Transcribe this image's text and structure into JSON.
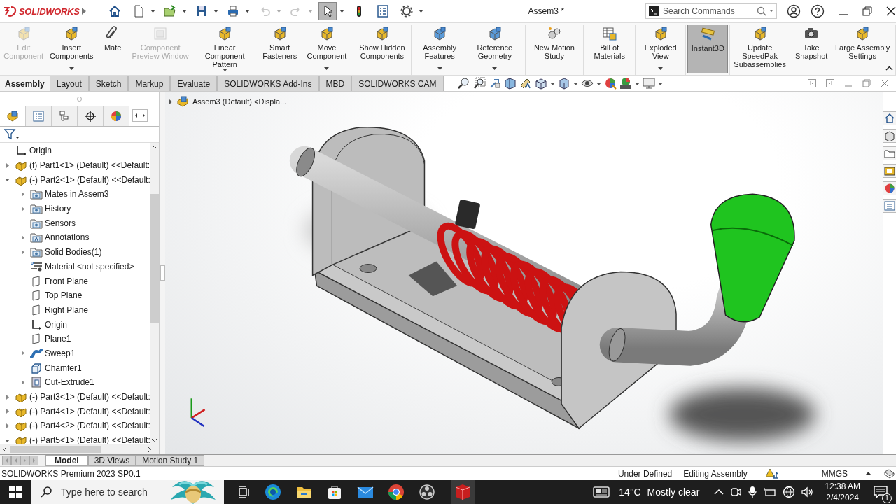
{
  "app": {
    "logo": "SOLIDWORKS"
  },
  "window": {
    "title": "Assem3 *"
  },
  "search": {
    "placeholder": "Search Commands"
  },
  "quick_access": [
    {
      "disabled": false,
      "selected": false,
      "dropdown": false
    },
    {
      "disabled": false,
      "selected": false,
      "dropdown": true
    },
    {
      "disabled": false,
      "selected": false,
      "dropdown": true
    },
    {
      "disabled": false,
      "selected": false,
      "dropdown": true
    },
    {
      "disabled": false,
      "selected": false,
      "dropdown": true
    },
    {
      "disabled": true,
      "selected": false,
      "dropdown": true
    },
    {
      "disabled": true,
      "selected": false,
      "dropdown": true
    },
    {
      "disabled": false,
      "selected": true,
      "dropdown": true
    },
    {
      "disabled": false,
      "selected": false,
      "dropdown": false
    },
    {
      "disabled": false,
      "selected": false,
      "dropdown": false
    },
    {
      "disabled": false,
      "selected": false,
      "dropdown": true
    }
  ],
  "ribbon": [
    {
      "items": [
        {
          "label": "Edit Component",
          "disabled": true,
          "dropdown": false,
          "selected": false
        },
        {
          "label": "Insert Components",
          "disabled": false,
          "dropdown": true,
          "selected": false
        },
        {
          "label": "Mate",
          "disabled": false,
          "dropdown": false,
          "selected": false
        },
        {
          "label": "Component Preview Window",
          "disabled": true,
          "dropdown": false,
          "selected": false
        },
        {
          "label": "Linear Component Pattern",
          "disabled": false,
          "dropdown": true,
          "selected": false
        },
        {
          "label": "Smart Fasteners",
          "disabled": false,
          "dropdown": false,
          "selected": false
        },
        {
          "label": "Move Component",
          "disabled": false,
          "dropdown": true,
          "selected": false
        }
      ]
    },
    {
      "items": [
        {
          "label": "Show Hidden Components",
          "disabled": false,
          "dropdown": false,
          "selected": false
        }
      ]
    },
    {
      "items": [
        {
          "label": "Assembly Features",
          "disabled": false,
          "dropdown": true,
          "selected": false
        },
        {
          "label": "Reference Geometry",
          "disabled": false,
          "dropdown": true,
          "selected": false
        }
      ]
    },
    {
      "items": [
        {
          "label": "New Motion Study",
          "disabled": false,
          "dropdown": false,
          "selected": false
        }
      ]
    },
    {
      "items": [
        {
          "label": "Bill of Materials",
          "disabled": false,
          "dropdown": false,
          "selected": false
        }
      ]
    },
    {
      "items": [
        {
          "label": "Exploded View",
          "disabled": false,
          "dropdown": true,
          "selected": false
        }
      ]
    },
    {
      "items": [
        {
          "label": "Instant3D",
          "disabled": false,
          "dropdown": false,
          "selected": true
        }
      ]
    },
    {
      "items": [
        {
          "label": "Update SpeedPak Subassemblies",
          "disabled": false,
          "dropdown": false,
          "selected": false
        }
      ]
    },
    {
      "items": [
        {
          "label": "Take Snapshot",
          "disabled": false,
          "dropdown": false,
          "selected": false
        },
        {
          "label": "Large Assembly Settings",
          "disabled": false,
          "dropdown": false,
          "selected": false
        }
      ]
    }
  ],
  "command_tabs": [
    {
      "label": "Assembly",
      "selected": true
    },
    {
      "label": "Layout",
      "selected": false
    },
    {
      "label": "Sketch",
      "selected": false
    },
    {
      "label": "Markup",
      "selected": false
    },
    {
      "label": "Evaluate",
      "selected": false
    },
    {
      "label": "SOLIDWORKS Add-Ins",
      "selected": false
    },
    {
      "label": "MBD",
      "selected": false
    },
    {
      "label": "SOLIDWORKS CAM",
      "selected": false
    }
  ],
  "panel_tabs": [
    {
      "selected": true
    },
    {
      "selected": false
    },
    {
      "selected": false
    },
    {
      "selected": false
    },
    {
      "selected": false
    }
  ],
  "feature_tree": {
    "items": [
      {
        "kind": "origin",
        "label": "Origin"
      },
      {
        "kind": "part",
        "label": "(f) Part1<1> (Default) <<Default:",
        "expanded": false
      },
      {
        "kind": "part",
        "label": "(-) Part2<1> (Default) <<Default:",
        "expanded": true,
        "children": [
          {
            "kind": "folder",
            "label": "Mates in Assem3",
            "expanded": false
          },
          {
            "kind": "folder",
            "label": "History",
            "expanded": false
          },
          {
            "kind": "folder",
            "label": "Sensors"
          },
          {
            "kind": "annotations",
            "label": "Annotations",
            "expanded": false
          },
          {
            "kind": "folder",
            "label": "Solid Bodies(1)",
            "expanded": false
          },
          {
            "kind": "material",
            "label": "Material <not specified>"
          },
          {
            "kind": "plane",
            "label": "Front Plane"
          },
          {
            "kind": "plane",
            "label": "Top Plane"
          },
          {
            "kind": "plane",
            "label": "Right Plane"
          },
          {
            "kind": "origin",
            "label": "Origin"
          },
          {
            "kind": "plane",
            "label": "Plane1"
          },
          {
            "kind": "sweep",
            "label": "Sweep1",
            "expanded": false
          },
          {
            "kind": "chamfer",
            "label": "Chamfer1"
          },
          {
            "kind": "cut",
            "label": "Cut-Extrude1",
            "expanded": false
          }
        ]
      },
      {
        "kind": "part",
        "label": "(-) Part3<1> (Default) <<Default:",
        "expanded": false
      },
      {
        "kind": "part",
        "label": "(-) Part4<1> (Default) <<Default:",
        "expanded": false
      },
      {
        "kind": "part",
        "label": "(-) Part4<2> (Default) <<Default:",
        "expanded": false
      },
      {
        "kind": "part",
        "label": "(-) Part5<1> (Default) <<Default:",
        "expanded": true
      }
    ]
  },
  "viewport": {
    "breadcrumb": "Assem3 (Default) <Displa..."
  },
  "bottom_tabs": [
    {
      "label": "Model",
      "selected": true
    },
    {
      "label": "3D Views",
      "selected": false
    },
    {
      "label": "Motion Study 1",
      "selected": false
    }
  ],
  "status_bar": {
    "product": "SOLIDWORKS Premium 2023 SP0.1",
    "state": "Under Defined",
    "mode": "Editing Assembly",
    "units": "MMGS"
  },
  "taskbar": {
    "search_placeholder": "Type here to search",
    "temperature": "14°C",
    "weather": "Mostly clear",
    "time": "12:38 AM",
    "date": "2/4/2024",
    "notifications": "1"
  }
}
